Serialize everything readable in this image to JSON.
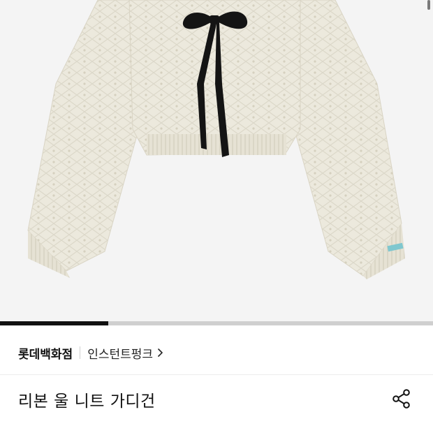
{
  "product": {
    "image_alt": "리본 울 니트 가디건",
    "carousel_progress": 0.25
  },
  "brand": {
    "store": "롯데백화점",
    "shop": "인스턴트펑크"
  },
  "title": "리본 울 니트 가디건",
  "icons": {
    "share": "share-icon",
    "chevron": "chevron-right-icon"
  },
  "colors": {
    "knit": "#ece9dd",
    "ribbon": "#141414",
    "progress": "#111111"
  }
}
